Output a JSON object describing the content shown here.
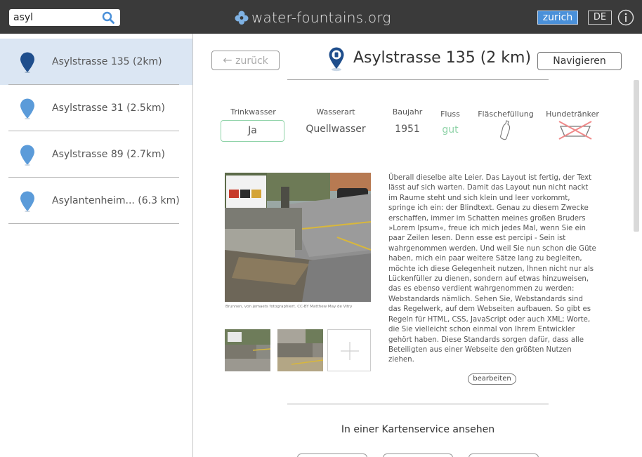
{
  "header": {
    "search": {
      "value": "asyl",
      "icon": "search-icon"
    },
    "brand": "water-fountains.org",
    "city": "zurich",
    "language": "DE",
    "info_icon": "info-icon"
  },
  "sidebar": {
    "results": [
      {
        "label": "Asylstrasse 135  (2km)",
        "selected": true
      },
      {
        "label": "Asylstrasse 31 (2.5km)",
        "selected": false
      },
      {
        "label": "Asylstrasse 89 (2.7km)",
        "selected": false
      },
      {
        "label": "Asylantenheim... (6.3 km)",
        "selected": false
      }
    ]
  },
  "detail": {
    "back_label": "zurück",
    "title": "Asylstrasse 135 (2 km)",
    "navigate_label": "Navigieren",
    "attributes": {
      "trinkwasser": {
        "label": "Trinkwasser",
        "value": "Ja"
      },
      "wasserart": {
        "label": "Wasserart",
        "value": "Quellwasser"
      },
      "baujahr": {
        "label": "Baujahr",
        "value": "1951"
      },
      "fluss": {
        "label": "Fluss",
        "value": "gut"
      },
      "flaschefuellung": {
        "label": "Fläschefüllung",
        "icon": "bottle-icon"
      },
      "hundetraenker": {
        "label": "Hundetränker",
        "icon": "dog-bowl-crossed-icon"
      }
    },
    "photo_caption": "Brunnen, von jemaets fotographiert. CC-BY Matthew May de Vitry",
    "description": "Überall dieselbe alte Leier. Das Layout ist fertig, der Text lässt auf sich warten. Damit das Layout nun nicht nackt im Raume steht und sich klein und leer vorkommt, springe ich ein: der Blindtext. Genau zu diesem Zwecke erschaffen, immer im Schatten meines großen Bruders »Lorem Ipsum«, freue ich mich jedes Mal, wenn Sie ein paar Zeilen lesen. Denn esse est percipi - Sein ist wahrgenommen werden. Und weil Sie nun schon die Güte haben, mich ein paar weitere Sätze lang zu begleiten, möchte ich diese Gelegenheit nutzen, Ihnen nicht nur als Lückenfüller zu dienen, sondern auf etwas hinzuweisen, das es ebenso verdient wahrgenommen zu werden: Webstandards nämlich. Sehen Sie, Webstandards sind das Regelwerk, auf dem Webseiten aufbauen. So gibt es Regeln für HTML, CSS, JavaScript oder auch XML; Worte, die Sie vielleicht schon einmal von Ihrem Entwickler gehört haben. Diese Standards sorgen dafür, dass alle Beteiligten aus einer Webseite den größten Nutzen ziehen.",
    "edit_label": "bearbeiten",
    "map_heading": "In einer Kartenservice ansehen"
  },
  "colors": {
    "topbar": "#3a3a3a",
    "accent": "#4a90d9",
    "selected_row": "#dbe6f3",
    "pin_selected": "#1f4e8c",
    "pin": "#5b9bd9",
    "flow_good": "#8fd3a8"
  }
}
